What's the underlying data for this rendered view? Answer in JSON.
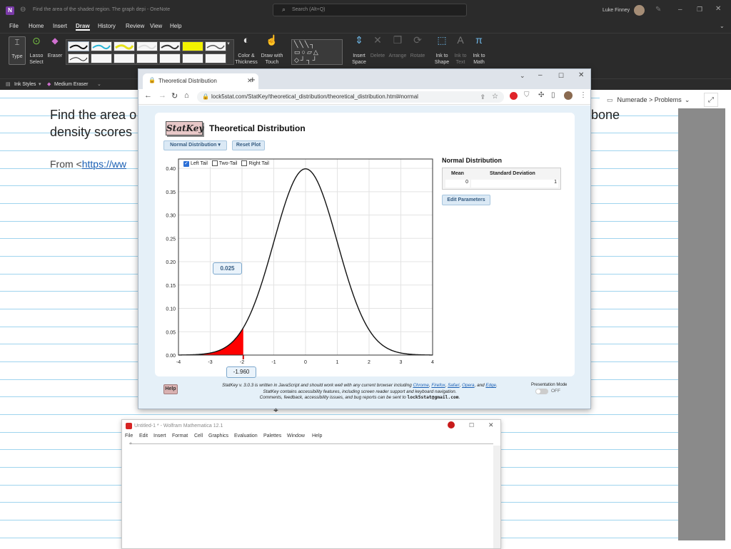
{
  "onenote": {
    "title": "Find the area of the shaded region. The graph depi  -  OneNote",
    "search": "Search (Alt+Q)",
    "user": "Luke Finney",
    "menu": [
      "File",
      "Home",
      "Insert",
      "Draw",
      "History",
      "Review",
      "View",
      "Help"
    ],
    "active_menu": "Draw",
    "ribbon": {
      "type": "Type",
      "lasso": "Lasso\nSelect",
      "eraser": "Eraser",
      "color": "Color &\nThickness",
      "draw_touch": "Draw with\nTouch",
      "insert_space": "Insert\nSpace",
      "delete": "Delete",
      "arrange": "Arrange",
      "rotate": "Rotate",
      "ink_shape": "Ink to\nShape",
      "ink_text": "Ink to\nText",
      "ink_math": "Ink to\nMath"
    },
    "sub": {
      "ink_styles": "Ink Styles",
      "medium_eraser": "Medium Eraser"
    },
    "breadcrumb": "Numerade > Problems",
    "note_line1_left": "Find the area o",
    "note_line1_right": "bone",
    "note_line2": "density scores",
    "from_prefix": "From <",
    "from_link": "https://ww"
  },
  "browser": {
    "tab_title": "Theoretical Distribution",
    "url": "lock5stat.com/StatKey/theoretical_distribution/theoretical_distribution.html#normal"
  },
  "statkey": {
    "logo": "StatKey",
    "heading": "Theoretical Distribution",
    "dist_button": "Normal Distribution",
    "reset_button": "Reset Plot",
    "left_tail": "Left Tail",
    "two_tail": "Two-Tail",
    "right_tail": "Right Tail",
    "left_tail_checked": true,
    "area_label": "0.025",
    "cutoff_label": "-1.960",
    "panel_title": "Normal Distribution",
    "param_headers": [
      "Mean",
      "Standard Deviation"
    ],
    "param_values": [
      "0",
      "1"
    ],
    "edit_params": "Edit Parameters",
    "help": "Help",
    "footer1_prefix": "StatKey v. 3.0.3 is written in JavaScript and should work well with any current browser including ",
    "footer_browsers": [
      "Chrome",
      "Firefox",
      "Safari",
      "Opera",
      "Edge"
    ],
    "footer2": "StatKey contains accessibility features, including screen reader support and keyboard navigation.",
    "footer3_prefix": "Comments, feedback, accessibility issues, and bug reports can be sent to ",
    "footer3_email": "lock5stat@gmail.com",
    "presentation_mode": "Presentation Mode",
    "presentation_state": "OFF"
  },
  "chart_data": {
    "type": "area",
    "title": "",
    "distribution": "Normal",
    "mean": 0,
    "sd": 1,
    "xlim": [
      -4,
      4
    ],
    "ylim": [
      0,
      0.42
    ],
    "x_ticks": [
      -4,
      -3,
      -2,
      -1,
      0,
      1,
      2,
      3,
      4
    ],
    "y_ticks": [
      "0.00",
      "0.05",
      "0.10",
      "0.15",
      "0.20",
      "0.25",
      "0.30",
      "0.35",
      "0.40"
    ],
    "shaded_region": {
      "tail": "left",
      "upper_bound": -1.96,
      "area": 0.025,
      "color": "#ff0000"
    },
    "grid": true
  },
  "mathematica": {
    "title": "Untitled-1 * - Wolfram Mathematica 12.1",
    "menu": [
      "File",
      "Edit",
      "Insert",
      "Format",
      "Cell",
      "Graphics",
      "Evaluation",
      "Palettes",
      "Window",
      "Help"
    ]
  }
}
